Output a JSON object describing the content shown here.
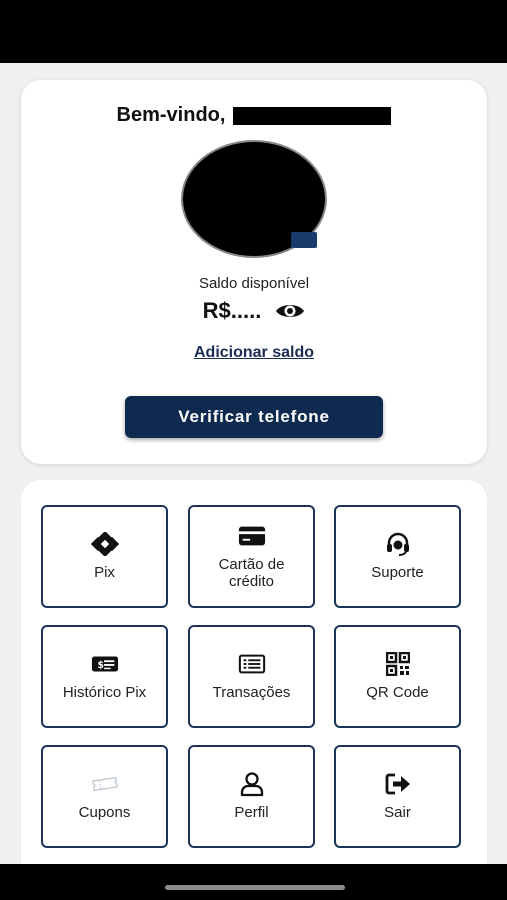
{
  "header": {
    "welcome": "Bem-vindo,"
  },
  "balance": {
    "label": "Saldo disponível",
    "value": "R$....."
  },
  "actions": {
    "add_balance": "Adicionar saldo",
    "verify_phone": "Verificar telefone"
  },
  "menu": {
    "items": [
      {
        "label": "Pix",
        "icon": "pix-icon"
      },
      {
        "label": "Cartão de\ncrédito",
        "icon": "credit-card-icon"
      },
      {
        "label": "Suporte",
        "icon": "headset-icon"
      },
      {
        "label": "Histórico Pix",
        "icon": "money-bill-icon"
      },
      {
        "label": "Transações",
        "icon": "list-icon"
      },
      {
        "label": "QR Code",
        "icon": "qr-code-icon"
      },
      {
        "label": "Cupons",
        "icon": "ticket-icon"
      },
      {
        "label": "Perfil",
        "icon": "user-icon"
      },
      {
        "label": "Sair",
        "icon": "logout-icon"
      }
    ]
  },
  "colors": {
    "primary": "#0f2a4f",
    "tile_border": "#1b3358",
    "background": "#f0f0f0"
  }
}
